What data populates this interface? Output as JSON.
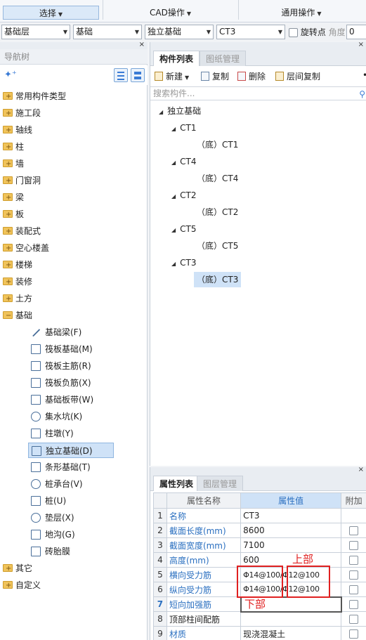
{
  "ribbon": {
    "select_label": "选择",
    "cad_label": "CAD操作",
    "general_label": "通用操作"
  },
  "filters": {
    "layer": "基础层",
    "category": "基础",
    "type": "独立基础",
    "component": "CT3",
    "rotate_label": "旋转点",
    "angle_label": "角度",
    "angle_value": "0"
  },
  "nav": {
    "title": "导航树",
    "categories": [
      "常用构件类型",
      "施工段",
      "轴线",
      "柱",
      "墙",
      "门窗洞",
      "梁",
      "板",
      "装配式",
      "空心楼盖",
      "楼梯",
      "装修",
      "土方",
      "基础"
    ],
    "foundation_children": [
      "基础梁(F)",
      "筏板基础(M)",
      "筏板主筋(R)",
      "筏板负筋(X)",
      "基础板带(W)",
      "集水坑(K)",
      "柱墩(Y)",
      "独立基础(D)",
      "条形基础(T)",
      "桩承台(V)",
      "桩(U)",
      "垫层(X)",
      "地沟(G)",
      "砖胎膜"
    ],
    "tail_categories": [
      "其它",
      "自定义"
    ]
  },
  "components": {
    "tab_list": "构件列表",
    "tab_drawings": "图纸管理",
    "toolbar": {
      "new": "新建",
      "copy": "复制",
      "delete": "删除",
      "floor_copy": "层间复制"
    },
    "search_placeholder": "搜索构件...",
    "root": "独立基础",
    "groups": [
      {
        "name": "CT1",
        "leaf": "（底）CT1"
      },
      {
        "name": "CT4",
        "leaf": "（底）CT4"
      },
      {
        "name": "CT2",
        "leaf": "（底）CT2"
      },
      {
        "name": "CT5",
        "leaf": "（底）CT5"
      },
      {
        "name": "CT3",
        "leaf": "（底）CT3"
      }
    ]
  },
  "properties": {
    "tab_list": "属性列表",
    "tab_layers": "图层管理",
    "headers": {
      "name": "属性名称",
      "value": "属性值",
      "extra": "附加"
    },
    "rows": [
      {
        "n": "1",
        "name": "名称",
        "value": "CT3"
      },
      {
        "n": "2",
        "name": "截面长度(mm)",
        "value": "8600"
      },
      {
        "n": "3",
        "name": "截面宽度(mm)",
        "value": "7100"
      },
      {
        "n": "4",
        "name": "高度(mm)",
        "value": "600"
      },
      {
        "n": "5",
        "name": "横向受力筋",
        "value": "Φ14@100/Φ12@100"
      },
      {
        "n": "6",
        "name": "纵向受力筋",
        "value": "Φ14@100/Φ12@100"
      },
      {
        "n": "7",
        "name": "短向加强筋",
        "value": ""
      },
      {
        "n": "8",
        "name": "顶部柱间配筋",
        "value": ""
      },
      {
        "n": "9",
        "name": "材质",
        "value": "现浇混凝土"
      }
    ],
    "annotation_top": "上部",
    "annotation_bottom": "下部"
  }
}
